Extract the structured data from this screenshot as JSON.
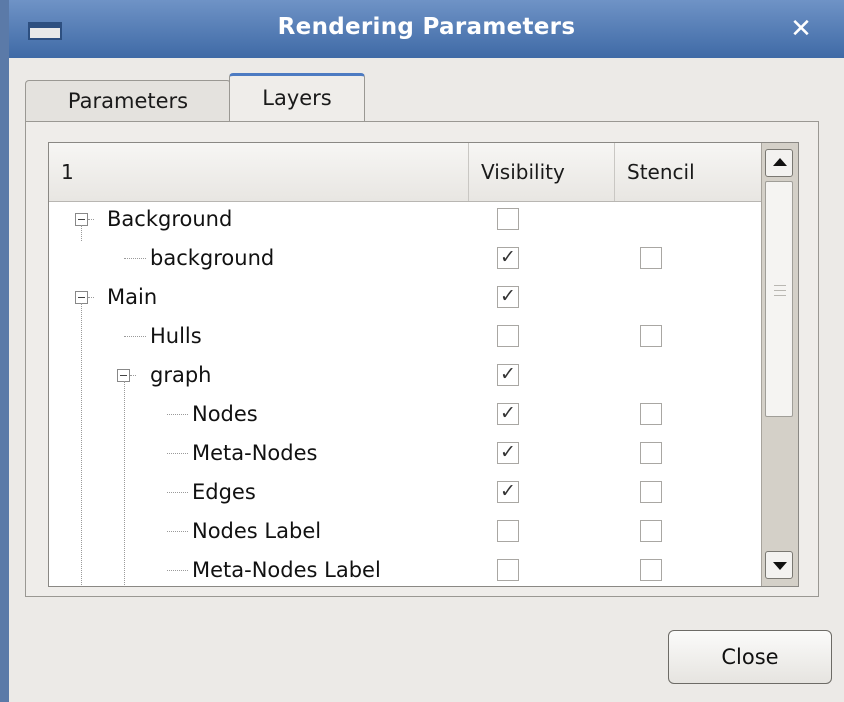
{
  "window": {
    "title": "Rendering Parameters",
    "close_glyph": "✕"
  },
  "tabs": [
    {
      "label": "Parameters",
      "active": false
    },
    {
      "label": "Layers",
      "active": true
    }
  ],
  "tree": {
    "columns": [
      "1",
      "Visibility",
      "Stencil"
    ],
    "rows": [
      {
        "label": "Background",
        "visible": false,
        "stencil": null
      },
      {
        "label": "background",
        "visible": true,
        "stencil": false
      },
      {
        "label": "Main",
        "visible": true,
        "stencil": null
      },
      {
        "label": "Hulls",
        "visible": false,
        "stencil": false
      },
      {
        "label": "graph",
        "visible": true,
        "stencil": null
      },
      {
        "label": "Nodes",
        "visible": true,
        "stencil": false
      },
      {
        "label": "Meta-Nodes",
        "visible": true,
        "stencil": false
      },
      {
        "label": "Edges",
        "visible": true,
        "stencil": false
      },
      {
        "label": "Nodes Label",
        "visible": false,
        "stencil": false
      },
      {
        "label": "Meta-Nodes Label",
        "visible": false,
        "stencil": false
      }
    ]
  },
  "footer": {
    "close_label": "Close"
  },
  "icons": {
    "check": "✓"
  }
}
